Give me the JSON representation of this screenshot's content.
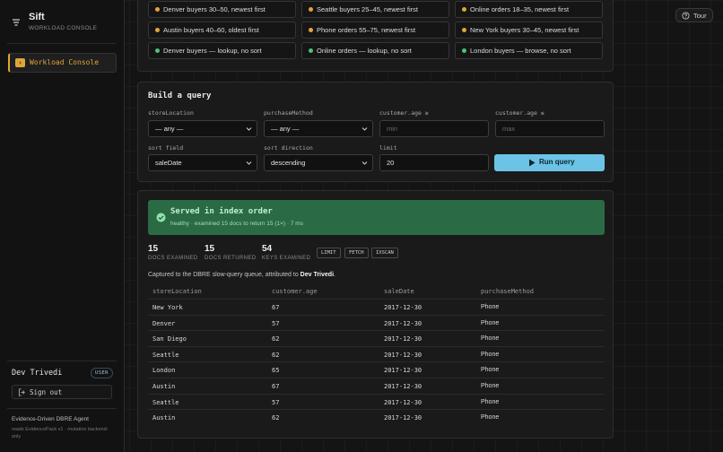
{
  "app": {
    "name": "Sift",
    "subtitle": "WORKLOAD CONSOLE"
  },
  "nav": {
    "items": [
      {
        "label": "Workload Console",
        "active": true
      }
    ]
  },
  "user": {
    "name": "Dev Trivedi",
    "role_badge": "USER",
    "signout_label": "Sign out"
  },
  "agent": {
    "title": "Evidence-Driven DBRE Agent",
    "subtitle": "reads EvidencePack v1 · mutation backend-only"
  },
  "tour": {
    "label": "Tour"
  },
  "presets": [
    {
      "label": "Denver buyers 30–50, newest first",
      "dot": "#e0a53a"
    },
    {
      "label": "Seattle buyers 25–45, newest first",
      "dot": "#e0a53a"
    },
    {
      "label": "Online orders 18–35, newest first",
      "dot": "#e0a53a"
    },
    {
      "label": "Austin buyers 40–60, oldest first",
      "dot": "#e0a53a"
    },
    {
      "label": "Phone orders 55–75, newest first",
      "dot": "#e0a53a"
    },
    {
      "label": "New York buyers 30–45, newest first",
      "dot": "#e0a53a"
    },
    {
      "label": "Denver buyers — lookup, no sort",
      "dot": "#4cc27a"
    },
    {
      "label": "Online orders — lookup, no sort",
      "dot": "#4cc27a"
    },
    {
      "label": "London buyers — browse, no sort",
      "dot": "#4cc27a"
    }
  ],
  "query": {
    "title": "Build a query",
    "store_location": {
      "label": "storeLocation",
      "value": "— any —"
    },
    "purchase_method": {
      "label": "purchaseMethod",
      "value": "— any —"
    },
    "age_min": {
      "label": "customer.age ≥",
      "placeholder": "min"
    },
    "age_max": {
      "label": "customer.age ≤",
      "placeholder": "max"
    },
    "sort_field": {
      "label": "sort field",
      "value": "saleDate"
    },
    "sort_direction": {
      "label": "sort direction",
      "value": "descending"
    },
    "limit": {
      "label": "limit",
      "value": "20"
    },
    "run_label": "Run query"
  },
  "result": {
    "status_title": "Served in index order",
    "status_sub": "healthy · examined 15 docs to return 15 (1×) · 7 ms",
    "metrics": [
      {
        "value": "15",
        "label": "DOCS EXAMINED"
      },
      {
        "value": "15",
        "label": "DOCS RETURNED"
      },
      {
        "value": "54",
        "label": "KEYS EXAMINED"
      }
    ],
    "stages": [
      "LIMIT",
      "FETCH",
      "IXSCAN"
    ],
    "captured_prefix": "Captured to the DBRE slow-query queue, attributed to ",
    "captured_user": "Dev Trivedi",
    "captured_suffix": ".",
    "columns": [
      "storeLocation",
      "customer.age",
      "saleDate",
      "purchaseMethod"
    ],
    "rows": [
      [
        "New York",
        "67",
        "2017-12-30",
        "Phone"
      ],
      [
        "Denver",
        "57",
        "2017-12-30",
        "Phone"
      ],
      [
        "San Diego",
        "62",
        "2017-12-30",
        "Phone"
      ],
      [
        "Seattle",
        "62",
        "2017-12-30",
        "Phone"
      ],
      [
        "London",
        "65",
        "2017-12-30",
        "Phone"
      ],
      [
        "Austin",
        "67",
        "2017-12-30",
        "Phone"
      ],
      [
        "Seattle",
        "57",
        "2017-12-30",
        "Phone"
      ],
      [
        "Austin",
        "62",
        "2017-12-30",
        "Phone"
      ]
    ]
  },
  "colors": {
    "accent": "#e0a53a",
    "run_button": "#6cc3e6",
    "success": "#2a6b46"
  }
}
